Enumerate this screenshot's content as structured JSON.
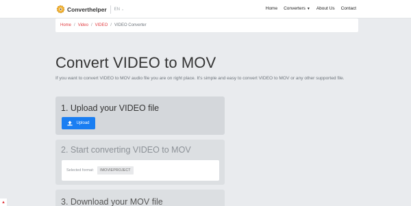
{
  "header": {
    "brand": "Converthelper",
    "language": "EN",
    "nav": [
      {
        "label": "Home"
      },
      {
        "label": "Converters"
      },
      {
        "label": "About Us"
      },
      {
        "label": "Contact"
      }
    ]
  },
  "breadcrumb": {
    "items": [
      "Home",
      "Video",
      "VIDEO"
    ],
    "current": "VIDEO Converter",
    "separator": "/"
  },
  "main": {
    "title": "Convert VIDEO to MOV",
    "intro": "If you want to convert VIDEO to MOV audio file you are on right place. It's simple and easy to convert VIDEO to MOV or any other supported file."
  },
  "steps": {
    "upload": {
      "title": "1. Upload your VIDEO file",
      "button_label": "Upload"
    },
    "convert": {
      "title": "2. Start converting VIDEO to MOV",
      "format_label": "Selected format:",
      "format_value": "IMOVIEPROJECT"
    },
    "download": {
      "title": "3. Download your MOV file"
    }
  },
  "colors": {
    "accent_red": "#e0393e",
    "button_blue": "#1a7ef2",
    "page_bg": "#e9ebee"
  },
  "icons": {
    "brand": "gear-logo-icon",
    "language_caret": "chevron-down-icon",
    "upload": "upload-icon",
    "scroll_top": "arrow-up-icon"
  }
}
